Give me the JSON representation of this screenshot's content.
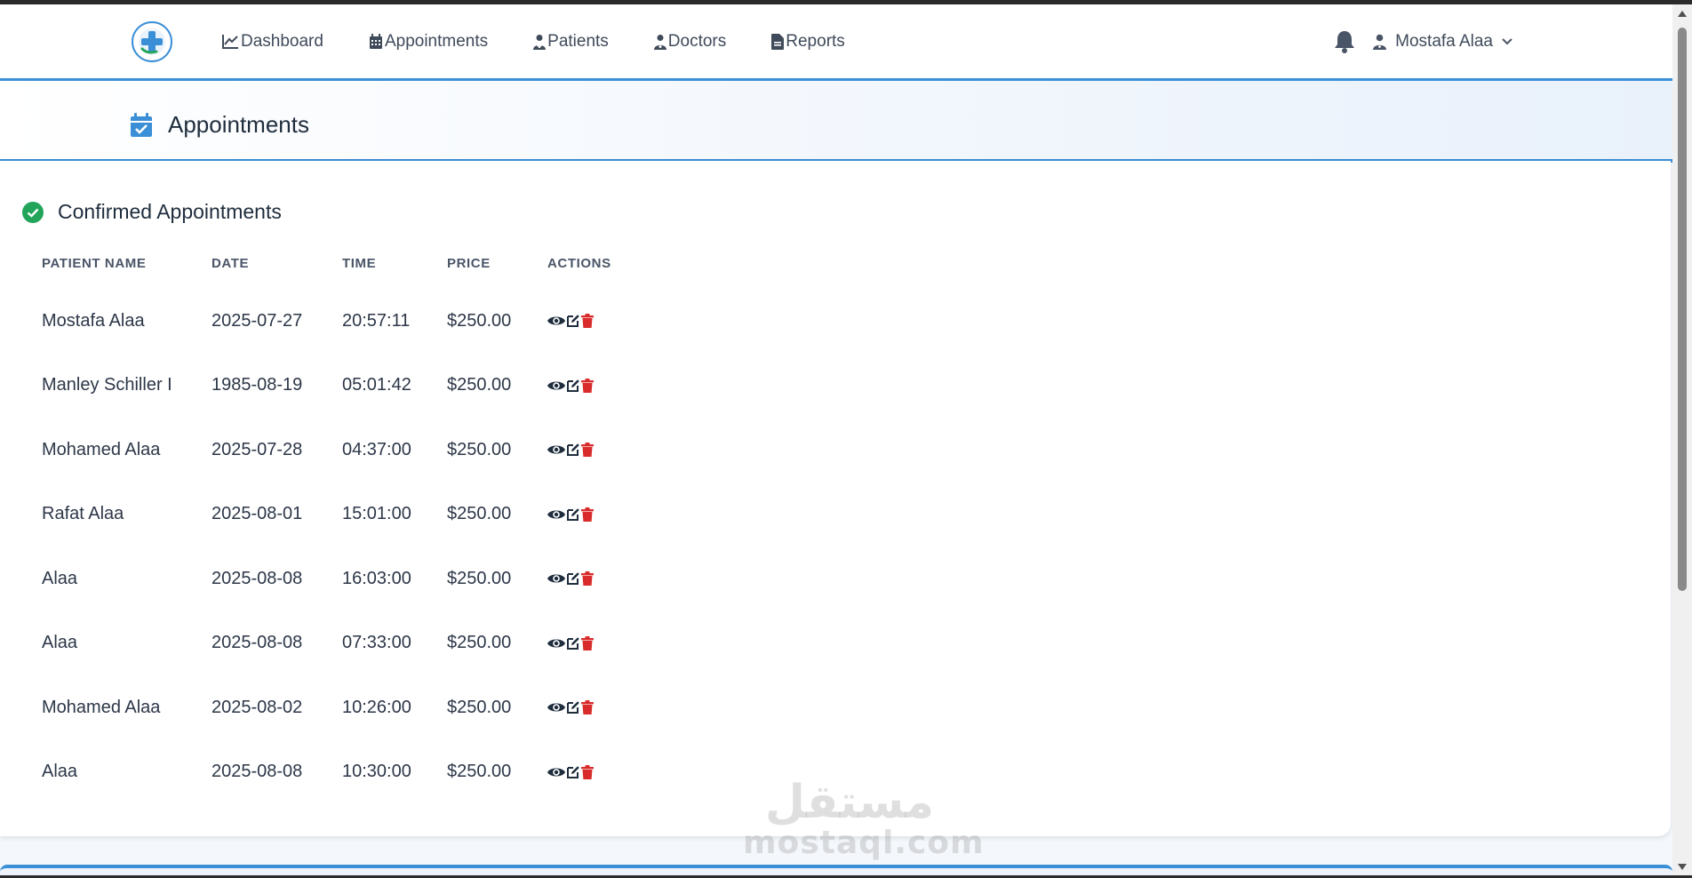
{
  "nav": {
    "items": [
      {
        "label": "Dashboard",
        "icon": "chart-line-icon"
      },
      {
        "label": "Appointments",
        "icon": "calendar-icon"
      },
      {
        "label": "Patients",
        "icon": "patient-icon"
      },
      {
        "label": "Doctors",
        "icon": "doctor-icon"
      },
      {
        "label": "Reports",
        "icon": "report-icon"
      }
    ],
    "user_name": "Mostafa Alaa"
  },
  "header": {
    "title": "Appointments"
  },
  "card": {
    "title": "Confirmed Appointments"
  },
  "table": {
    "columns": [
      "PATIENT NAME",
      "DATE",
      "TIME",
      "PRICE",
      "ACTIONS"
    ],
    "rows": [
      {
        "name": "Mostafa Alaa",
        "date": "2025-07-27",
        "time": "20:57:11",
        "price": "$250.00"
      },
      {
        "name": "Manley Schiller I",
        "date": "1985-08-19",
        "time": "05:01:42",
        "price": "$250.00"
      },
      {
        "name": "Mohamed Alaa",
        "date": "2025-07-28",
        "time": "04:37:00",
        "price": "$250.00"
      },
      {
        "name": "Rafat Alaa",
        "date": "2025-08-01",
        "time": "15:01:00",
        "price": "$250.00"
      },
      {
        "name": "Alaa",
        "date": "2025-08-08",
        "time": "16:03:00",
        "price": "$250.00"
      },
      {
        "name": "Alaa",
        "date": "2025-08-08",
        "time": "07:33:00",
        "price": "$250.00"
      },
      {
        "name": "Mohamed Alaa",
        "date": "2025-08-02",
        "time": "10:26:00",
        "price": "$250.00"
      },
      {
        "name": "Alaa",
        "date": "2025-08-08",
        "time": "10:30:00",
        "price": "$250.00"
      }
    ]
  },
  "watermark": {
    "arabic": "مستقل",
    "latin": "mostaql.com"
  },
  "colors": {
    "accent": "#3b8fd6",
    "success": "#22a55a",
    "danger": "#d92b2b",
    "icon_dark": "#1f2d3d"
  }
}
